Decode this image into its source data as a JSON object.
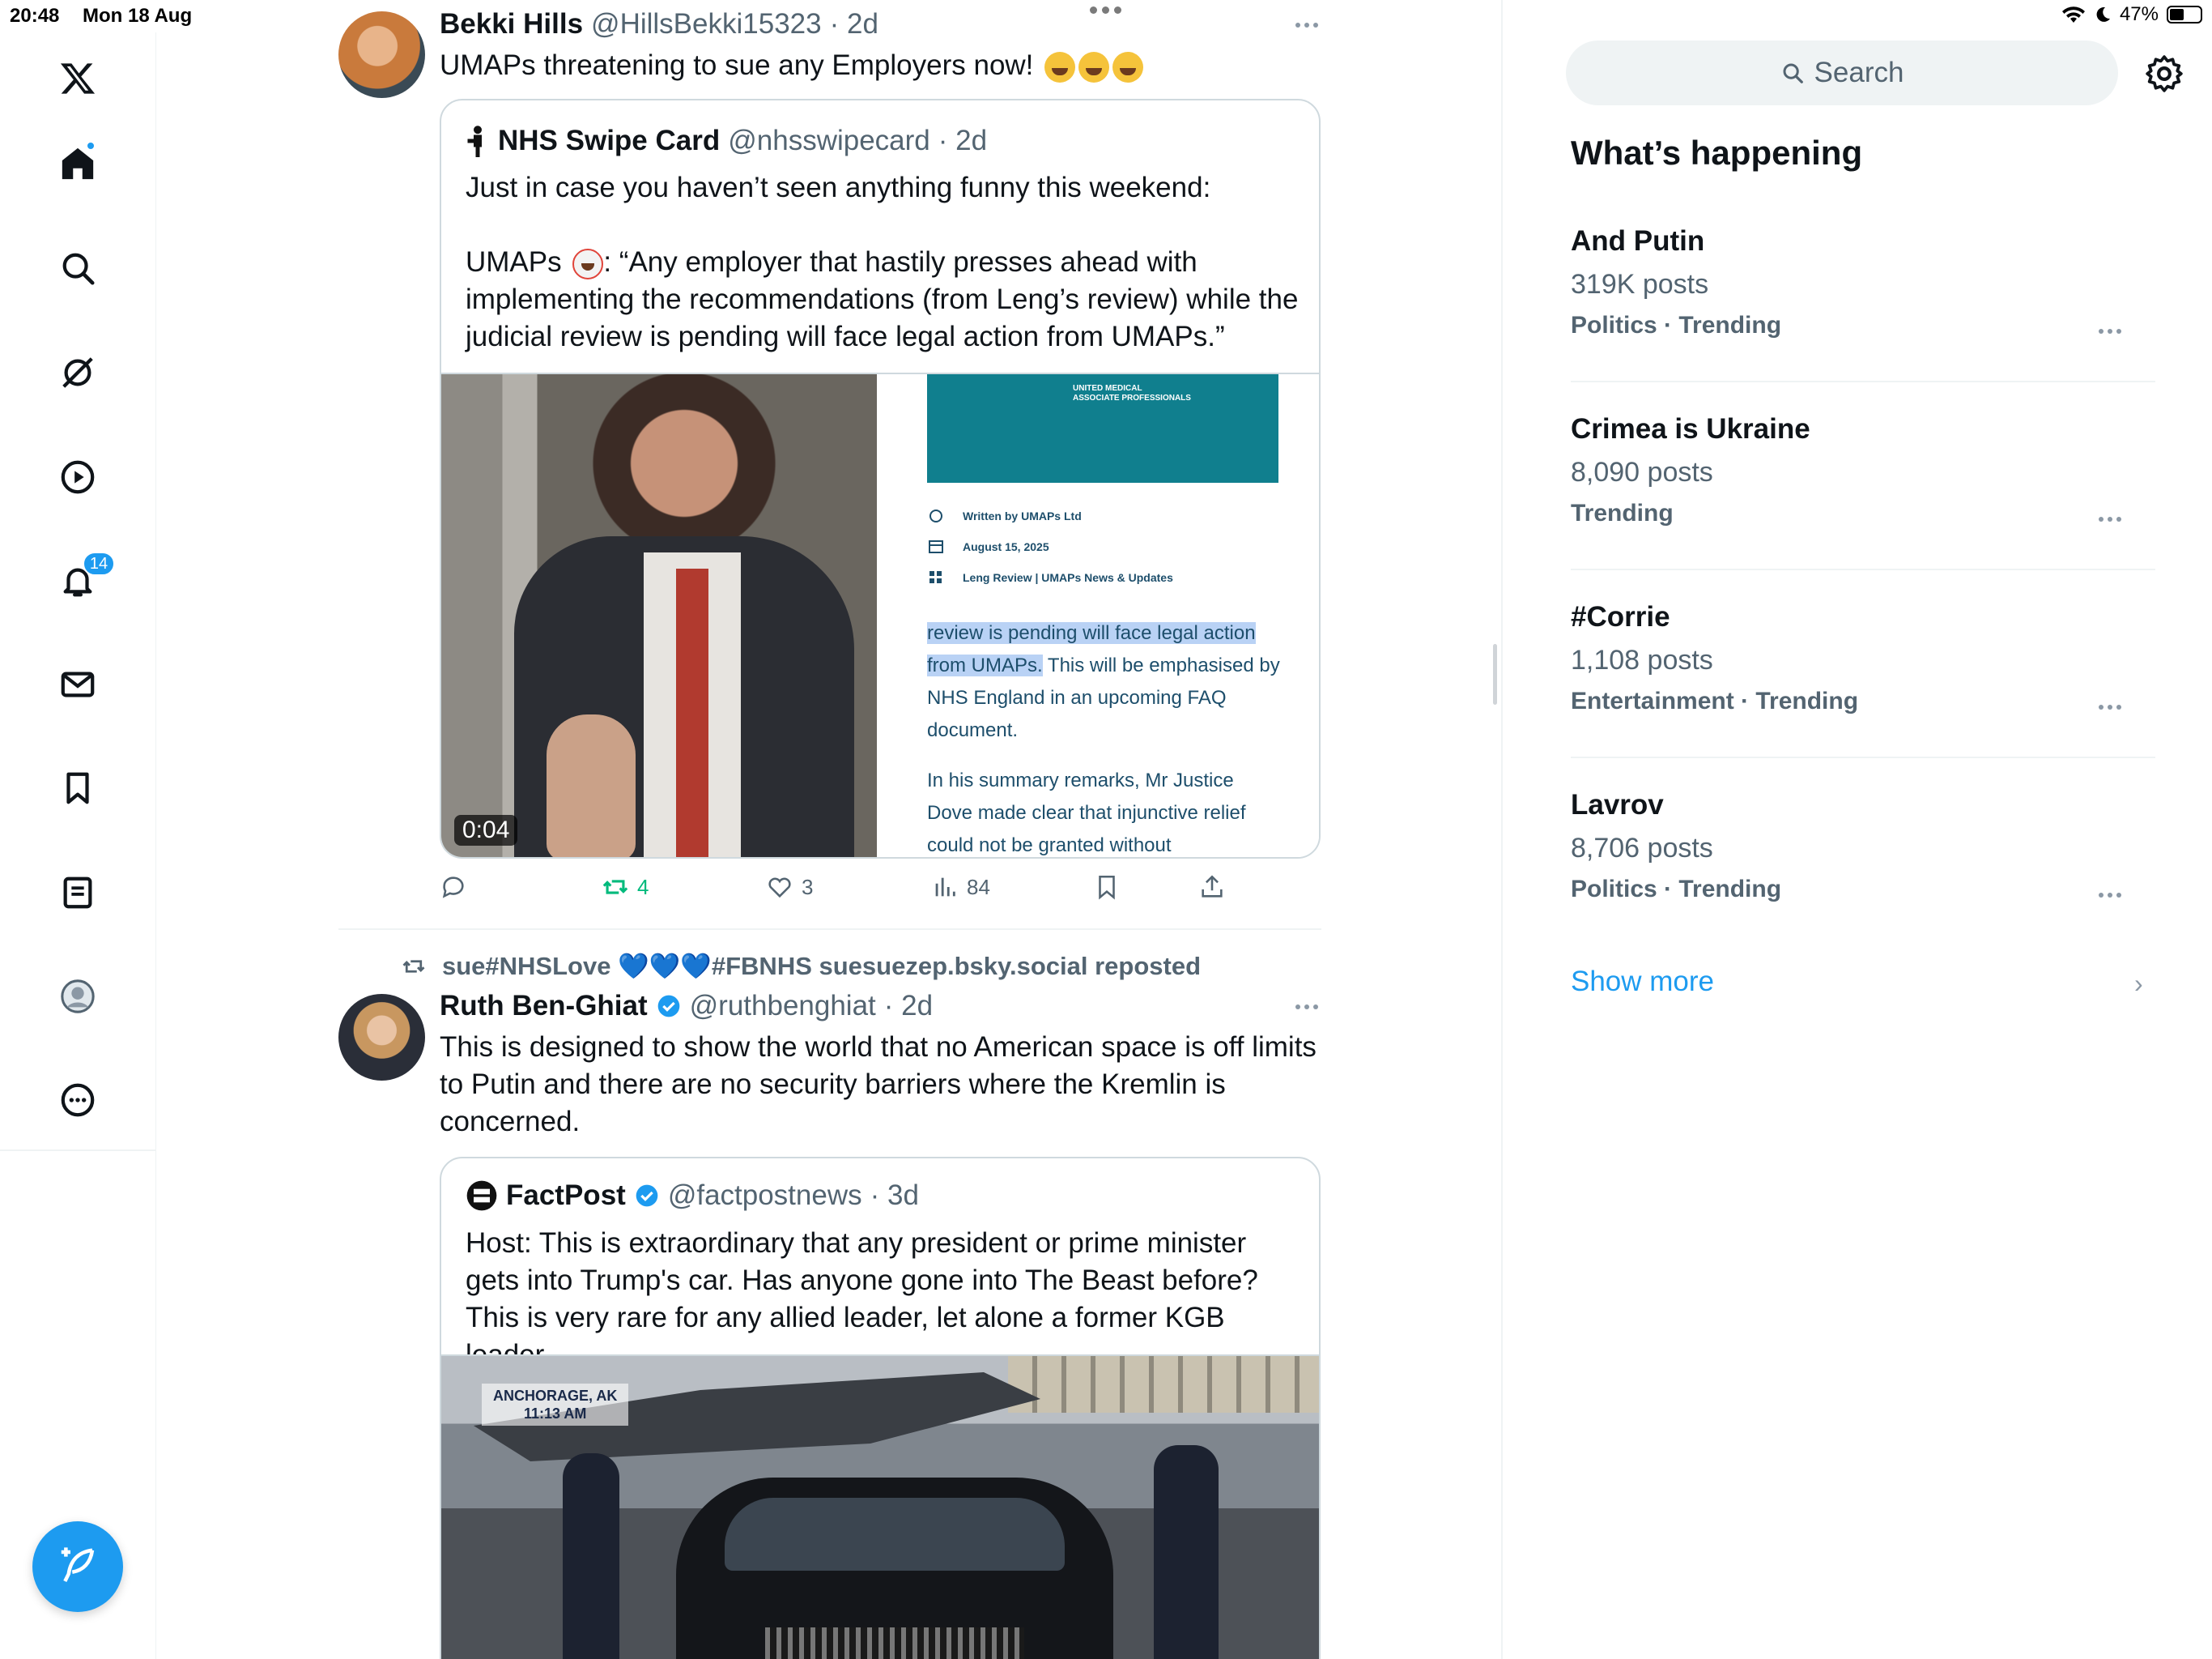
{
  "status": {
    "time": "20:48",
    "date": "Mon 18 Aug",
    "battery": "47%",
    "battery_level": 0.47
  },
  "nav": {
    "notifications_badge": "14",
    "icons": [
      "x-logo-icon",
      "home-icon",
      "search-icon",
      "grok-icon",
      "video-icon",
      "bell-icon",
      "mail-icon",
      "bookmark-icon",
      "lists-icon",
      "profile-icon",
      "more-icon"
    ]
  },
  "post1": {
    "name": "Bekki Hills",
    "handle": "@HillsBekki15323",
    "time": "· 2d",
    "text": "UMAPs threatening to sue any Employers now!",
    "quote": {
      "name": "NHS Swipe Card",
      "handle": "@nhsswipecard",
      "time": "· 2d",
      "text1": "Just in case you haven’t seen anything funny this weekend:",
      "text2a": "UMAPs",
      "text2b": ": “Any employer that hastily presses ahead with implementing the recommendations (from Leng’s review) while the judicial review is pending will face legal action from UMAPs.”",
      "video_duration": "0:04",
      "doc": {
        "org_line1": "UNITED MEDICAL",
        "org_line2": "ASSOCIATE PROFESSIONALS",
        "written_by": "Written by UMAPs Ltd",
        "date": "August 15, 2025",
        "category": "Leng Review | UMAPs News & Updates",
        "highlight": "review is pending will face legal action from UMAPs.",
        "body1": " This will be emphasised by NHS England in an upcoming FAQ document.",
        "body2": "In his summary remarks, Mr Justice Dove made clear that injunctive relief could not be granted without"
      }
    },
    "reposts": "4",
    "likes": "3",
    "views": "84"
  },
  "post2": {
    "repost_label": "sue#NHSLove 💙💙💙#FBNHS suesuezep.bsky.social reposted",
    "name": "Ruth Ben-Ghiat",
    "handle": "@ruthbenghiat",
    "time": "· 2d",
    "text": "This is designed to show the world that no American space is off limits to Putin and there are no security barriers where the Kremlin is concerned.",
    "quote": {
      "name": "FactPost",
      "handle": "@factpostnews",
      "time": "· 3d",
      "text": "Host: This is extraordinary that any president or prime minister gets into Trump's car. Has anyone gone into The Beast before? This is very rare for any allied leader, let alone a former KGB leader",
      "overlay_location": "ANCHORAGE, AK",
      "overlay_time": "11:13 AM"
    }
  },
  "sidebar": {
    "search_placeholder": "Search",
    "title": "What’s happening",
    "trends": [
      {
        "name": "And Putin",
        "count": "319K posts",
        "meta": "Politics · Trending"
      },
      {
        "name": "Crimea is Ukraine",
        "count": "8,090 posts",
        "meta": "Trending"
      },
      {
        "name": "#Corrie",
        "count": "1,108 posts",
        "meta": "Entertainment · Trending"
      },
      {
        "name": "Lavrov",
        "count": "8,706 posts",
        "meta": "Politics · Trending"
      }
    ],
    "show_more": "Show more"
  }
}
